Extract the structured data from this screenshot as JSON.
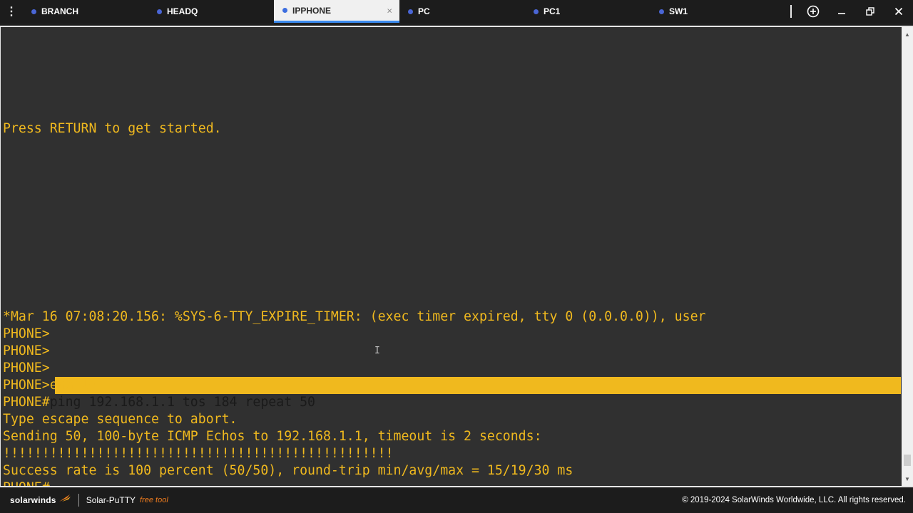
{
  "tabs": [
    {
      "label": "BRANCH",
      "active": false
    },
    {
      "label": "HEADQ",
      "active": false
    },
    {
      "label": "IPPHONE",
      "active": true
    },
    {
      "label": "PC",
      "active": false
    },
    {
      "label": "PC1",
      "active": false
    },
    {
      "label": "SW1",
      "active": false
    }
  ],
  "tab_close_glyph": "×",
  "menu_glyph": "⋮",
  "terminal": {
    "lines": [
      {
        "row": 5,
        "text": "Press RETURN to get started."
      },
      {
        "row": 16,
        "text": "*Mar 16 07:08:20.156: %SYS-6-TTY_EXPIRE_TIMER: (exec timer expired, tty 0 (0.0.0.0)), user"
      },
      {
        "row": 17,
        "text": "PHONE>"
      },
      {
        "row": 18,
        "text": "PHONE>"
      },
      {
        "row": 19,
        "text": "PHONE>"
      },
      {
        "row": 20,
        "text": "PHONE>enable"
      },
      {
        "row": 22,
        "text": "Type escape sequence to abort."
      },
      {
        "row": 23,
        "text": "Sending 50, 100-byte ICMP Echos to 192.168.1.1, timeout is 2 seconds:"
      },
      {
        "row": 24,
        "text": "!!!!!!!!!!!!!!!!!!!!!!!!!!!!!!!!!!!!!!!!!!!!!!!!!!"
      },
      {
        "row": 25,
        "text": "Success rate is 100 percent (50/50), round-trip min/avg/max = 15/19/30 ms"
      },
      {
        "row": 26,
        "text": "PHONE#"
      }
    ],
    "prompt_line": {
      "prompt": "PHONE#",
      "command": "ping 192.168.1.1 tos 184 repeat 50"
    }
  },
  "footer": {
    "logo": "solarwinds",
    "app_name": "Solar-PuTTY",
    "free_tool": "free tool",
    "copyright": "© 2019-2024 SolarWinds Worldwide, LLC. All rights reserved."
  },
  "colors": {
    "terminal_bg": "#303030",
    "terminal_fg": "#f0b91e",
    "highlight_bg": "#f0b91e",
    "accent_tab": "#3c8cf0",
    "tab_dot": "#4a66d6"
  }
}
